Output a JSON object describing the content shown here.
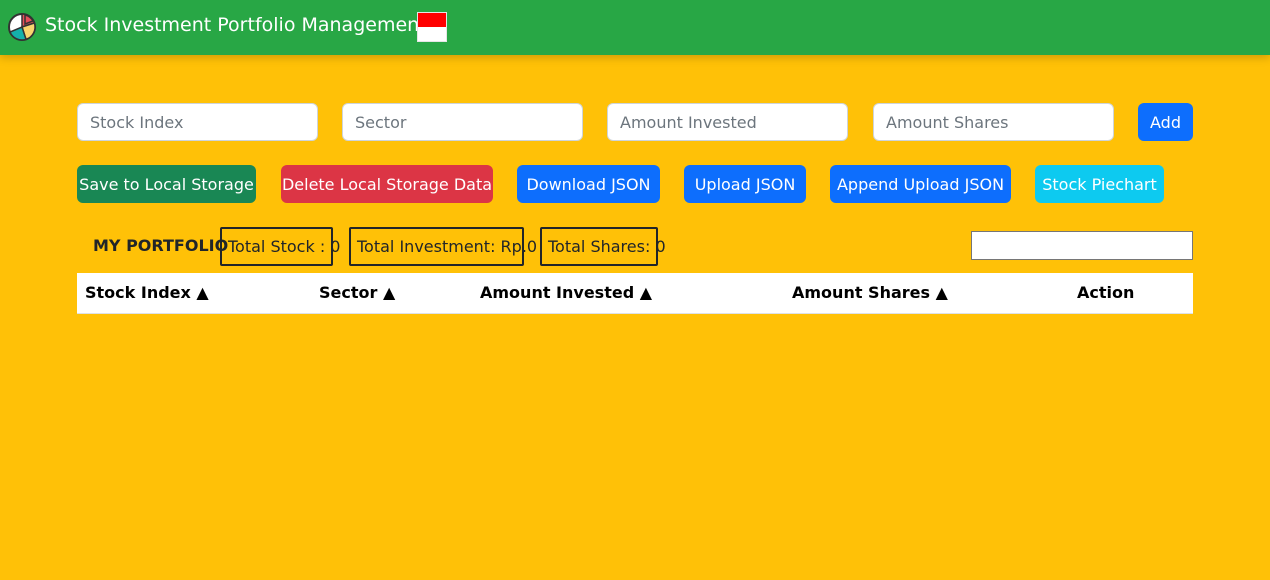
{
  "header": {
    "title": "Stock Investment Portfolio Management",
    "logo_icon": "pie-chart-icon",
    "flag_icon": "indonesia-flag-icon",
    "colors": {
      "navbar": "#28a745",
      "background": "#ffc107"
    }
  },
  "form": {
    "stock_index_placeholder": "Stock Index",
    "sector_placeholder": "Sector",
    "amount_invested_placeholder": "Amount Invested",
    "amount_shares_placeholder": "Amount Shares",
    "add_label": "Add"
  },
  "actions": {
    "save_local": "Save to Local Storage",
    "delete_local": "Delete Local Storage Data",
    "download_json": "Download JSON",
    "upload_json": "Upload JSON",
    "append_upload_json": "Append Upload JSON",
    "stock_piechart": "Stock Piechart"
  },
  "summary": {
    "label": "MY PORTFOLIO",
    "total_stock": "Total Stock : 0",
    "total_investment": "Total Investment: Rp.0",
    "total_shares": "Total Shares: 0",
    "filter_value": ""
  },
  "table": {
    "columns": [
      "Stock Index ▲",
      "Sector ▲",
      "Amount Invested ▲",
      "Amount Shares ▲",
      "Action"
    ],
    "rows": []
  }
}
